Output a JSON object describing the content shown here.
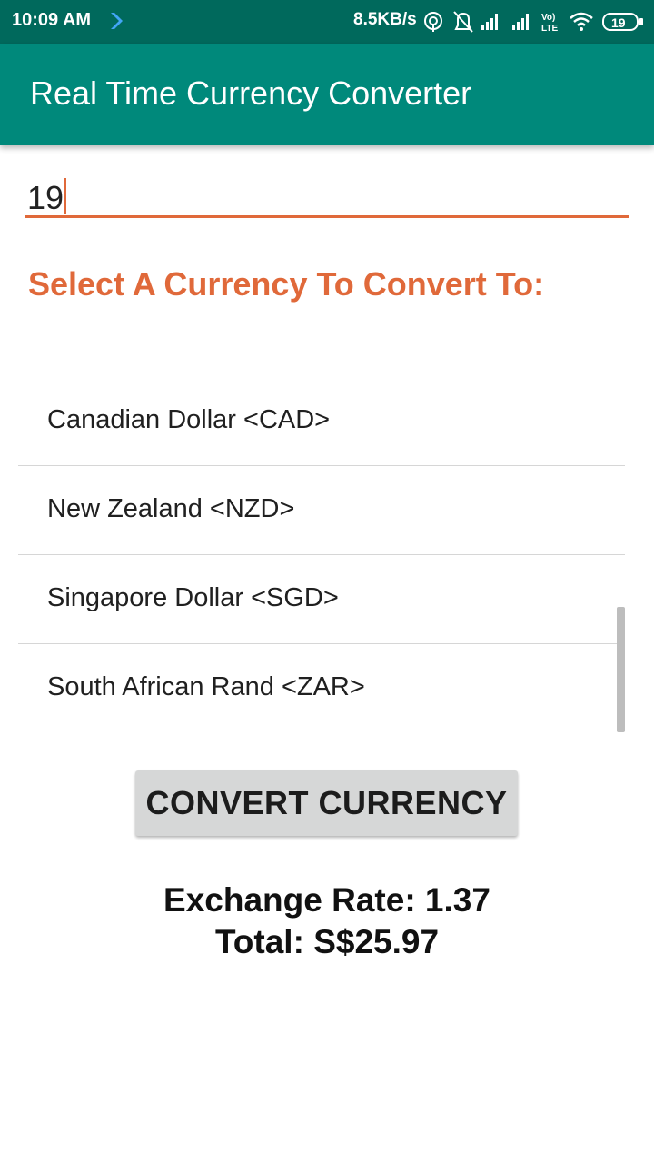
{
  "status_bar": {
    "time": "10:09 AM",
    "network_speed": "8.5KB/s",
    "battery": "19",
    "volte_label_top": "Vo)",
    "volte_label_bottom": "LTE",
    "icons": [
      "arrow-right-icon",
      "hotspot-icon",
      "alarm-off-icon",
      "signal-icon",
      "signal-icon",
      "volte-icon",
      "wifi-icon",
      "battery-icon"
    ]
  },
  "app_bar": {
    "title": "Real Time Currency Converter",
    "color": "#00897b"
  },
  "amount_input": {
    "value": "19"
  },
  "select_label": "Select A Currency To Convert To:",
  "currency_list": {
    "items": [
      {
        "label": "Canadian Dollar <CAD>"
      },
      {
        "label": "New Zealand <NZD>"
      },
      {
        "label": "Singapore Dollar <SGD>"
      },
      {
        "label": "South African Rand <ZAR>"
      }
    ]
  },
  "convert_button": {
    "label": "CONVERT CURRENCY"
  },
  "result": {
    "exchange_rate": "Exchange Rate: 1.37",
    "total": "Total: S$25.97"
  },
  "colors": {
    "status_bar": "#00695c",
    "accent": "#e0693a",
    "button_bg": "#d6d7d7"
  }
}
